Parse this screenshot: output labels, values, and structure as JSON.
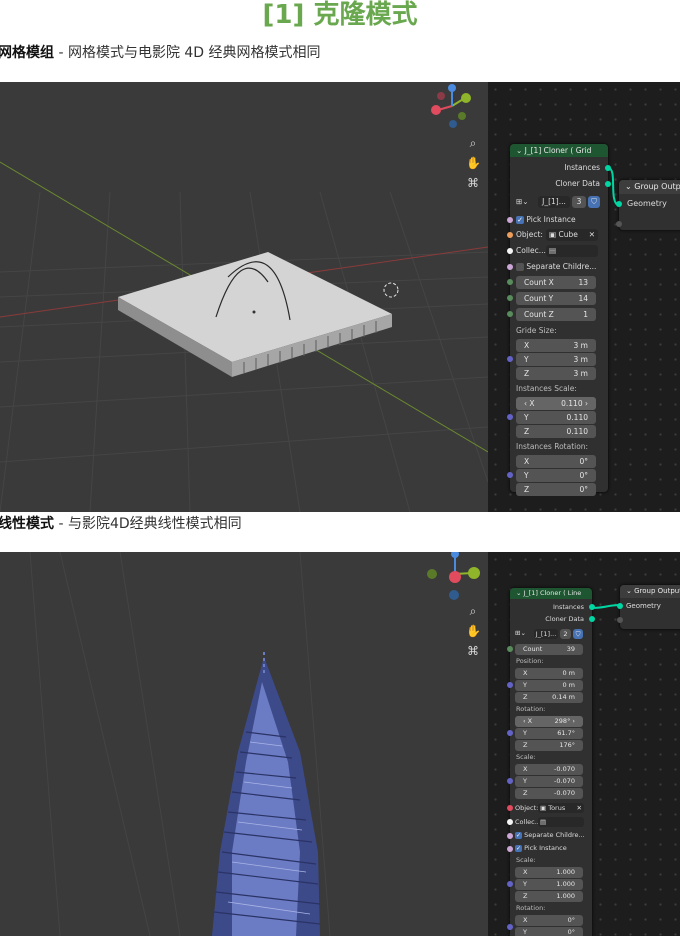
{
  "page": {
    "title": "[1] 克隆模式",
    "grid_caption_bold": "网格模组",
    "grid_caption_rest": " - 网格模式与电影院 4D 经典网格模式相同",
    "linear_caption_bold": "线性模式",
    "linear_caption_rest": " - 与影院4D经典线性模式相同"
  },
  "grid_panel": {
    "node_title": "J_[1] Cloner ( Grid",
    "outputs": [
      "Instances",
      "Cloner Data"
    ],
    "group_output": "Group Output",
    "group_output_socket": "Geometry",
    "datablock_name": "J_[1]...",
    "datablock_users": "3",
    "pick_instance": "Pick Instance",
    "object_label": "Object:",
    "object_value": "Cube",
    "collection_label": "Collec...",
    "separate_children": "Separate Childre...",
    "counts": [
      {
        "label": "Count X",
        "value": "13"
      },
      {
        "label": "Count Y",
        "value": "14"
      },
      {
        "label": "Count Z",
        "value": "1"
      }
    ],
    "grid_size_label": "Gride Size:",
    "grid_size": [
      {
        "axis": "X",
        "value": "3 m"
      },
      {
        "axis": "Y",
        "value": "3 m"
      },
      {
        "axis": "Z",
        "value": "3 m"
      }
    ],
    "scale_label": "Instances Scale:",
    "scale": [
      {
        "axis": "X",
        "value": "0.110"
      },
      {
        "axis": "Y",
        "value": "0.110"
      },
      {
        "axis": "Z",
        "value": "0.110"
      }
    ],
    "rotation_label": "Instances Rotation:",
    "rotation": [
      {
        "axis": "X",
        "value": "0°"
      },
      {
        "axis": "Y",
        "value": "0°"
      },
      {
        "axis": "Z",
        "value": "0°"
      }
    ]
  },
  "linear_panel": {
    "node_title": "J_[1] Cloner ( Line",
    "outputs": [
      "Instances",
      "Cloner Data"
    ],
    "group_output": "Group Output",
    "group_output_socket": "Geometry",
    "datablock_name": "J_[1]...",
    "datablock_users": "2",
    "count_label": "Count",
    "count_value": "39",
    "position_label": "Position:",
    "position": [
      {
        "axis": "X",
        "value": "0 m"
      },
      {
        "axis": "Y",
        "value": "0 m"
      },
      {
        "axis": "Z",
        "value": "0.14 m"
      }
    ],
    "rotation_label": "Rotation:",
    "rotation": [
      {
        "axis": "X",
        "value": "298°"
      },
      {
        "axis": "Y",
        "value": "61.7°"
      },
      {
        "axis": "Z",
        "value": "176°"
      }
    ],
    "scale_label": "Scale:",
    "scale": [
      {
        "axis": "X",
        "value": "-0.070"
      },
      {
        "axis": "Y",
        "value": "-0.070"
      },
      {
        "axis": "Z",
        "value": "-0.070"
      }
    ],
    "object_label": "Object:",
    "object_value": "Torus",
    "collection_label": "Collec...",
    "separate_children": "Separate Childre...",
    "pick_instance": "Pick Instance",
    "inst_scale_label": "Scale:",
    "inst_scale": [
      {
        "axis": "X",
        "value": "1.000"
      },
      {
        "axis": "Y",
        "value": "1.000"
      },
      {
        "axis": "Z",
        "value": "1.000"
      }
    ],
    "inst_rotation_label": "Rotation:",
    "inst_rotation": [
      {
        "axis": "X",
        "value": "0°"
      },
      {
        "axis": "Y",
        "value": "0°"
      }
    ]
  },
  "gizmo": {
    "x": "X",
    "y": "Y",
    "z": "Z"
  },
  "colors": {
    "title_green": "#6aa84f",
    "node_header": "#1e5632",
    "socket_geometry": "#00d6a3",
    "socket_bool": "#cca6d6",
    "socket_int": "#598c5c",
    "socket_vector": "#6363c7",
    "socket_object": "#ed9e5c",
    "socket_collection": "#f5f5f5",
    "field": "#545454",
    "accent_blue": "#4772b3"
  },
  "icons": [
    "search-icon",
    "hand-icon",
    "camera-icon",
    "node-tree-icon",
    "shield-icon",
    "cube-icon",
    "collection-icon",
    "close-icon",
    "chevron-down-icon",
    "checkbox-icon"
  ]
}
